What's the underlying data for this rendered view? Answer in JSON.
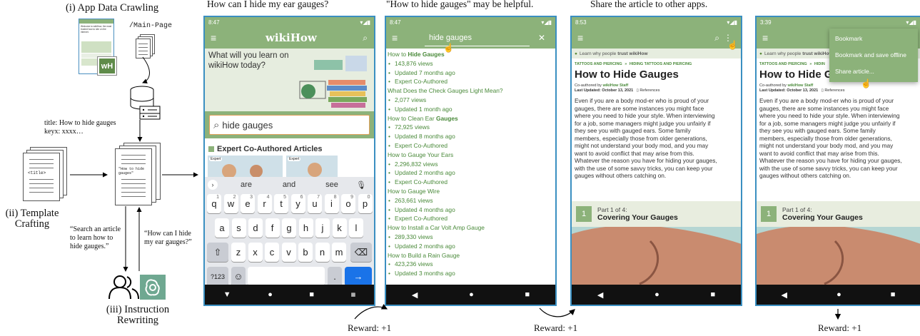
{
  "left": {
    "app_crawl_label": "(i) App Data Crawling",
    "main_page_label": "/Main-Page",
    "wikihow_phone_text": "Welcome to wikiHow, the most trusted how-to site on the internet.",
    "wh_logo": "wH",
    "title_keyx": [
      "title: How to hide gauges",
      "keyx: xxxx…"
    ],
    "title_tag": "<title>",
    "doc_text": "\"How to hide gauges\"",
    "template_label": [
      "(ii) Template",
      "Crafting"
    ],
    "quote_search": [
      "“Search an article",
      "to learn how to",
      "hide gauges.”"
    ],
    "quote_how": [
      "“How can I hide",
      "my ear gauges?”"
    ],
    "rewrite_label": [
      "(iii) Instruction",
      "Rewriting"
    ]
  },
  "captions": {
    "p1": "How can I hide my ear gauges?",
    "p2": "\"How to hide gauges\" may be helpful.",
    "p3": "Share the article to other apps."
  },
  "rewards": [
    "Reward: +1",
    "Reward: +1",
    "Reward: +1"
  ],
  "phone1": {
    "time": "8:47",
    "logo": "wikiHow",
    "prompt": [
      "What will you learn on",
      "wikiHow today?"
    ],
    "search_value": "hide gauges",
    "section": "Expert Co-Authored Articles",
    "expert_badge": "Expert",
    "suggestions": [
      "are",
      "and",
      "see"
    ],
    "row1": [
      "q",
      "w",
      "e",
      "r",
      "t",
      "y",
      "u",
      "i",
      "o",
      "p"
    ],
    "row1_sup": [
      "1",
      "2",
      "3",
      "4",
      "5",
      "6",
      "7",
      "8",
      "9",
      "0"
    ],
    "row2": [
      "a",
      "s",
      "d",
      "f",
      "g",
      "h",
      "j",
      "k",
      "l"
    ],
    "row3": [
      "z",
      "x",
      "c",
      "v",
      "b",
      "n",
      "m"
    ],
    "sym_key": "?123",
    "comma_key": ",",
    "period_key": "."
  },
  "phone2": {
    "time": "8:47",
    "query": "hide gauges",
    "results": [
      {
        "pre": "How to ",
        "hl": "Hide Gauges",
        "post": "",
        "views": "143,876 views",
        "updated": "Updated 7 months ago",
        "expert": "Expert Co-Authored"
      },
      {
        "pre": "What Does the Check Gauges Light Mean?",
        "hl": "",
        "post": "",
        "views": "2,077 views",
        "updated": "Updated 1 month ago",
        "expert": ""
      },
      {
        "pre": "How to Clean Ear ",
        "hl": "Gauges",
        "post": "",
        "views": "72,925 views",
        "updated": "Updated 8 months ago",
        "expert": "Expert Co-Authored"
      },
      {
        "pre": "How to Gauge Your Ears",
        "hl": "",
        "post": "",
        "views": "2,296,832 views",
        "updated": "Updated 2 months ago",
        "expert": "Expert Co-Authored"
      },
      {
        "pre": "How to Gauge Wire",
        "hl": "",
        "post": "",
        "views": "263,661 views",
        "updated": "Updated 4 months ago",
        "expert": "Expert Co-Authored"
      },
      {
        "pre": "How to Install a Car Volt Amp Gauge",
        "hl": "",
        "post": "",
        "views": "289,330 views",
        "updated": "Updated 2 months ago",
        "expert": ""
      },
      {
        "pre": "How to Build a Rain Gauge",
        "hl": "",
        "post": "",
        "views": "423,236 views",
        "updated": "Updated 3 months ago",
        "expert": ""
      }
    ]
  },
  "phone3": {
    "time": "8:53",
    "trust_pre": "Learn why people ",
    "trust_b": "trust wikiHow",
    "crumb1": "TATTOOS AND PIERCING",
    "crumb_sep": "»",
    "crumb2": "HIDING TATTOOS AND PIERCING",
    "title": "How to Hide Gauges",
    "coauth_pre": "Co-authored by ",
    "coauth": "wikiHow Staff",
    "updated": "Last Updated: October 13, 2021",
    "references": "References",
    "body": [
      "Even if you are a body mod-er who is proud of your",
      "gauges, there are some instances you might face",
      "where you need to hide your style. When interviewing",
      "for a job, some managers might judge you unfairly if",
      "they see you with gauged ears. Some family",
      "members, especially those from older generations,",
      "might not understand your body mod, and you may",
      "want to avoid conflict that may arise from this.",
      "Whatever the reason you have for hiding your gauges,",
      "with the use of some savvy tricks, you can keep your",
      "gauges without others catching on."
    ],
    "part_num": "1",
    "part_of": "Part 1 of 4:",
    "part_title": "Covering Your Gauges"
  },
  "phone4": {
    "time": "3:39",
    "trust_pre": "Learn why people ",
    "trust_b": "trust wikiHow",
    "crumb1": "TATTOOS AND PIERCING",
    "crumb_sep": "»",
    "crumb2": "HIDIN",
    "title": "How to Hide Gauge",
    "coauth_pre": "Co-authored by ",
    "coauth": "wikiHow Staff",
    "updated": "Last Updated: October 13, 2021",
    "references": "References",
    "menu": [
      "Bookmark",
      "Bookmark and save offline",
      "Share article..."
    ],
    "body": [
      "Even if you are a body mod-er who is proud of your",
      "gauges, there are some instances you might face",
      "where you need to hide your style. When interviewing",
      "for a job, some managers might judge you unfairly if",
      "they see you with gauged ears. Some family",
      "members, especially those from older generations,",
      "might not understand your body mod, and you may",
      "want to avoid conflict that may arise from this.",
      "Whatever the reason you have for hiding your gauges,",
      "with the use of some savvy tricks, you can keep your",
      "gauges without others catching on."
    ],
    "part_num": "1",
    "part_of": "Part 1 of 4:",
    "part_title": "Covering Your Gauges"
  },
  "colors": {
    "wikihow_green": "#8cb27a",
    "text_green": "#4a8a3a",
    "phone_border": "#3a8fc1",
    "enter_blue": "#1a73e8"
  },
  "icons": [
    "menu-icon",
    "search-icon",
    "close-icon",
    "more-vert-icon",
    "back-nav-icon",
    "home-nav-icon",
    "recents-nav-icon",
    "hand-cursor-icon",
    "database-icon",
    "user-group-icon",
    "chatgpt-icon"
  ]
}
